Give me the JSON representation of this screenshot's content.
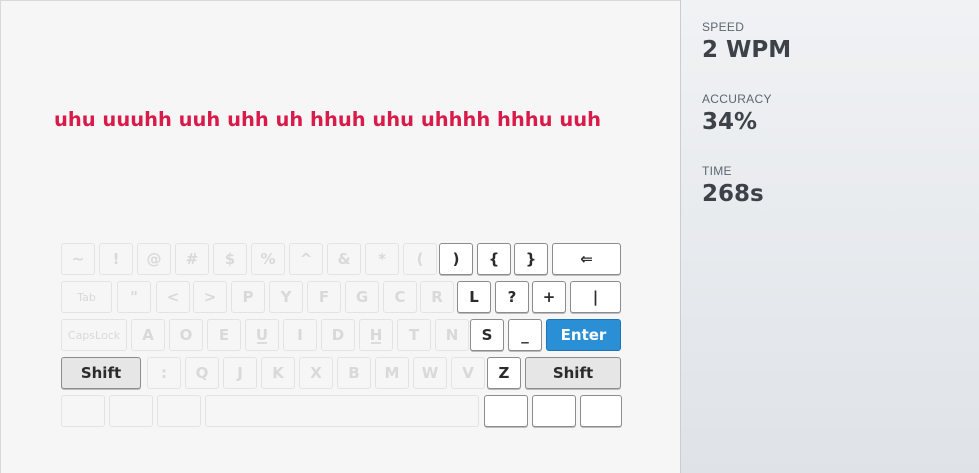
{
  "prompt_text": "uhu uuuhh uuh uhh uh hhuh uhu uhhhh hhhu uuh",
  "stats": [
    {
      "label": "SPEED",
      "value": "2 WPM"
    },
    {
      "label": "ACCURACY",
      "value": "34%"
    },
    {
      "label": "TIME",
      "value": "268s"
    }
  ],
  "keyboard": {
    "row1": [
      "~",
      "!",
      "@",
      "#",
      "$",
      "%",
      "^",
      "&",
      "*",
      "(",
      ")",
      "{",
      "}",
      "⇐"
    ],
    "row2": [
      "Tab",
      "\"",
      "<",
      ">",
      "P",
      "Y",
      "F",
      "G",
      "C",
      "R",
      "L",
      "?",
      "+",
      "|"
    ],
    "row3": [
      "CapsLock",
      "A",
      "O",
      "E",
      "U",
      "I",
      "D",
      "H",
      "T",
      "N",
      "S",
      "_",
      "Enter"
    ],
    "row4": [
      "Shift",
      ":",
      "Q",
      "J",
      "K",
      "X",
      "B",
      "M",
      "W",
      "V",
      "Z",
      "Shift"
    ],
    "row5": [
      "",
      "",
      "",
      "",
      "",
      "",
      ""
    ]
  },
  "colors": {
    "prompt": "#d81b4a",
    "enter": "#2b8fd6"
  }
}
